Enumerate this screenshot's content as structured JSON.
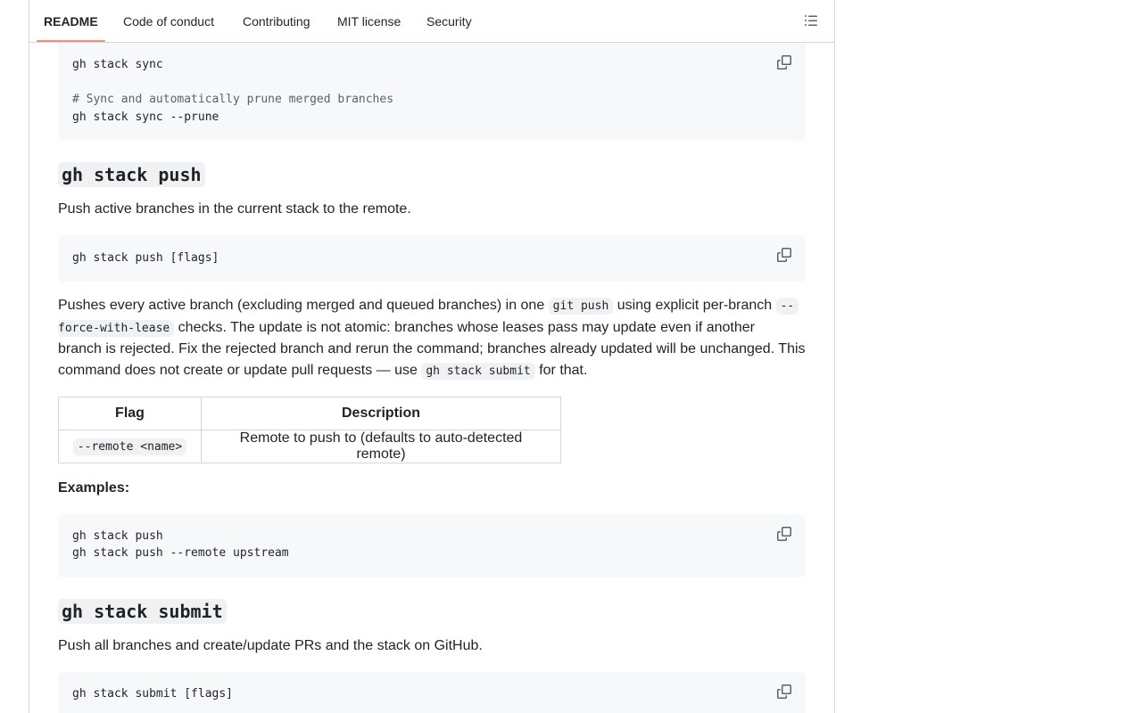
{
  "tabs": {
    "readme": "README",
    "code_of_conduct": "Code of conduct",
    "contributing": "Contributing",
    "license": "MIT license",
    "security": "Security"
  },
  "sync_block": {
    "line1": "gh stack sync",
    "comment": "# Sync and automatically prune merged branches",
    "line2": "gh stack sync --prune"
  },
  "push_section": {
    "heading": "gh stack push",
    "intro": "Push active branches in the current stack to the remote.",
    "usage": "gh stack push [flags]",
    "desc": {
      "l1_a": "Pushes every active branch (excluding merged and queued branches) in one ",
      "l1_code1": "git push",
      "l1_b": " using explicit per-branch ",
      "l1_code2": "--",
      "l2_code": "force-with-lease",
      "l2_b": " checks. The update is not atomic: branches whose leases pass may update even if another",
      "l3": "branch is rejected. Fix the rejected branch and rerun the command; branches already updated will be unchanged. This",
      "l4_a": "command does not create or update pull requests — use ",
      "l4_code": "gh stack submit",
      "l4_b": " for that."
    },
    "table": {
      "headers": [
        "Flag",
        "Description"
      ],
      "rows": [
        {
          "flag": "--remote <name>",
          "description": "Remote to push to (defaults to auto-detected remote)"
        }
      ]
    },
    "examples_label": "Examples:",
    "examples": [
      "gh stack push",
      "gh stack push --remote upstream"
    ]
  },
  "submit_section": {
    "heading": "gh stack submit",
    "intro": "Push all branches and create/update PRs and the stack on GitHub.",
    "usage": "gh stack submit [flags]"
  },
  "icons": {
    "copy": "copy-icon",
    "outline": "list-outline-icon"
  },
  "colors": {
    "active_tab_underline": "#fd8c73",
    "code_background": "#f6f8fa",
    "border": "#d1d9e0"
  }
}
